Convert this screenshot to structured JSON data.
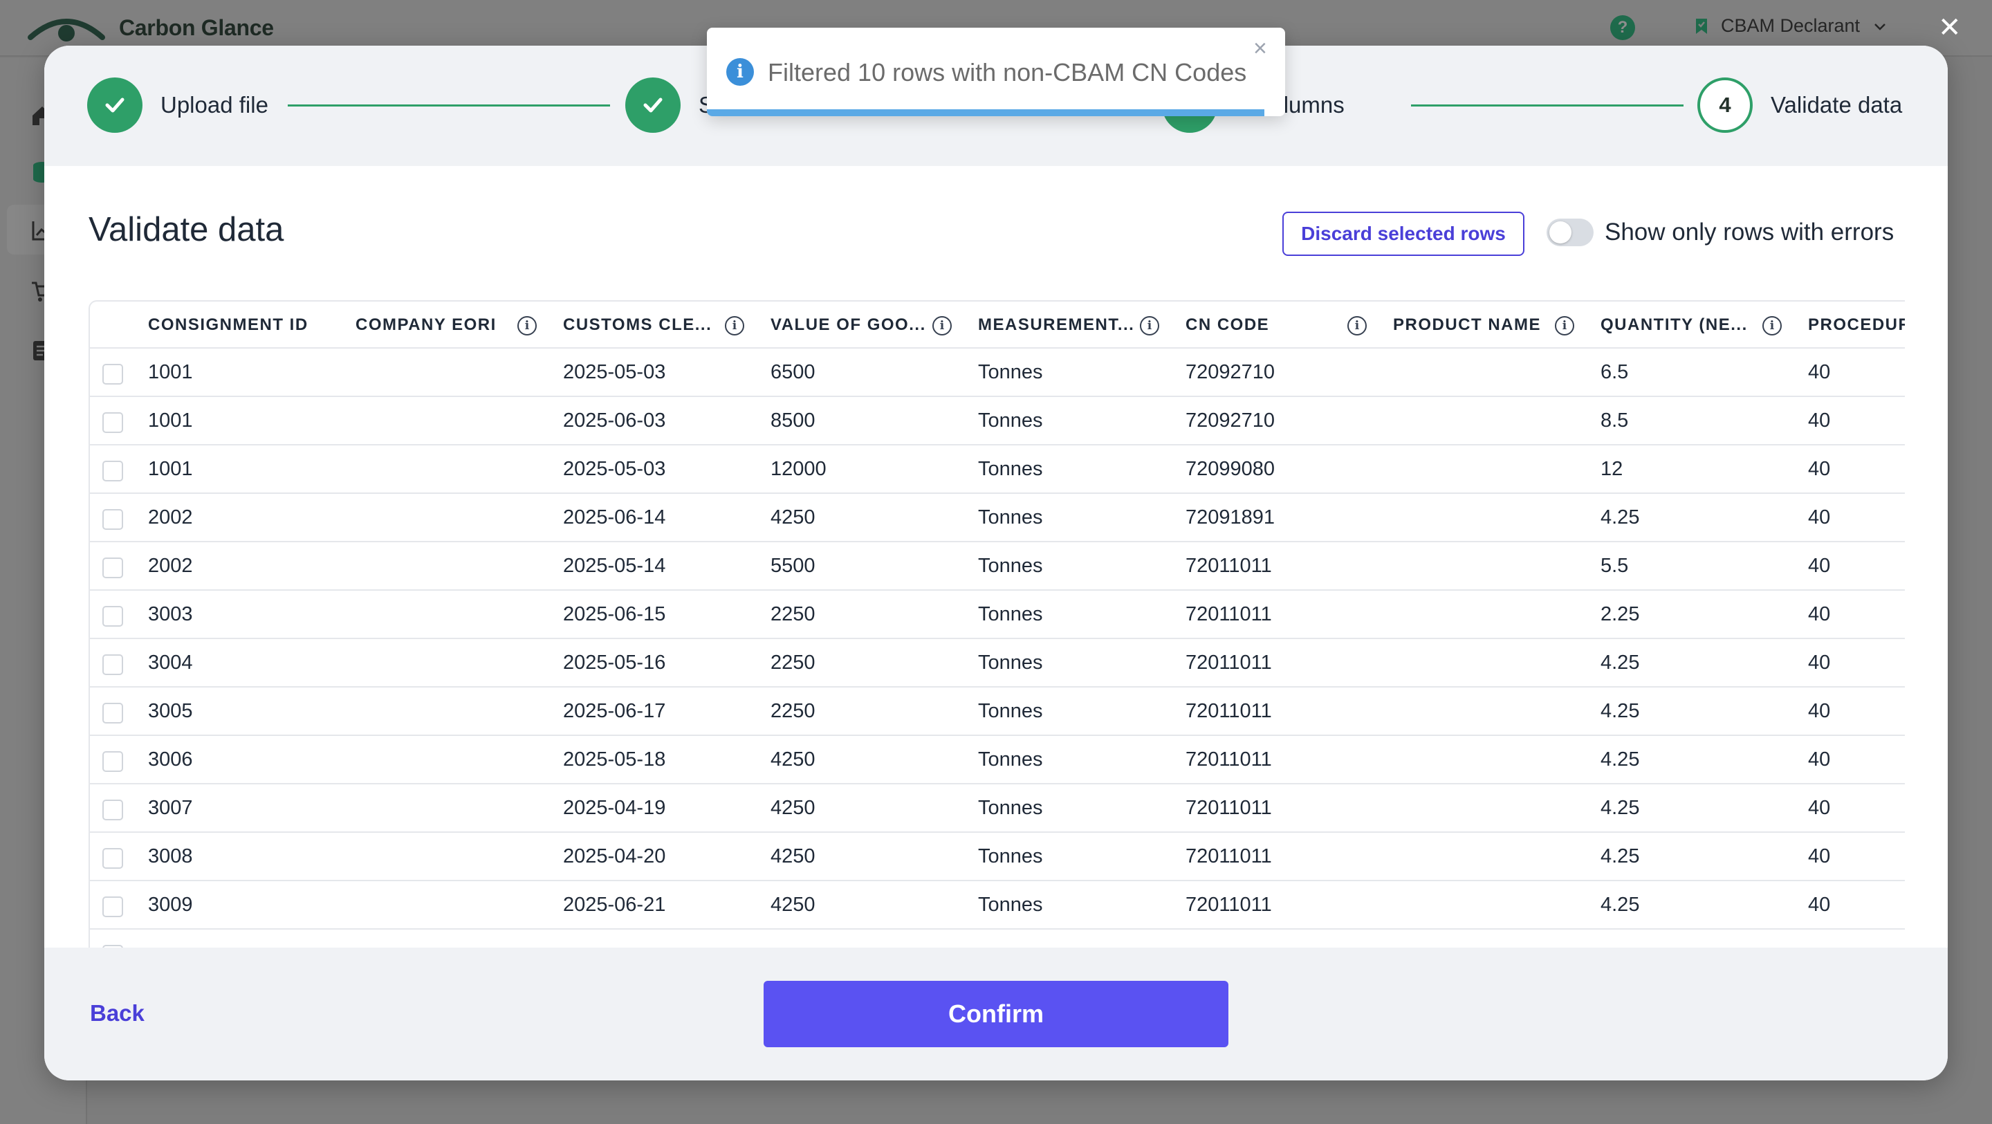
{
  "app": {
    "brand": "Carbon Glance",
    "role": "CBAM Declarant",
    "help_glyph": "?",
    "close_glyph": "✕",
    "colors": {
      "accent": "#5a52f2",
      "success": "#2e9f68",
      "info": "#3b8fd9"
    }
  },
  "toast": {
    "icon": "info-icon",
    "glyph": "i",
    "message": "Filtered 10 rows with non-CBAM CN Codes",
    "close_glyph": "×"
  },
  "stepper": {
    "steps": [
      {
        "label": "Upload file",
        "status": "complete"
      },
      {
        "label": "S",
        "status": "complete"
      },
      {
        "label": "h Columns",
        "status": "complete"
      },
      {
        "label": "Validate data",
        "status": "current",
        "number": "4"
      }
    ]
  },
  "main": {
    "title": "Validate data",
    "discard_label": "Discard selected rows",
    "toggle_label": "Show only rows with errors",
    "toggle_on": false
  },
  "table": {
    "info_glyph": "i",
    "columns": [
      {
        "label": "CONSIGNMENT ID",
        "info": false
      },
      {
        "label": "COMPANY EORI",
        "info": true
      },
      {
        "label": "CUSTOMS CLE...",
        "info": true
      },
      {
        "label": "VALUE OF GOO...",
        "info": true
      },
      {
        "label": "MEASUREMENT...",
        "info": true
      },
      {
        "label": "CN CODE",
        "info": true
      },
      {
        "label": "PRODUCT NAME",
        "info": true
      },
      {
        "label": "QUANTITY (NE...",
        "info": true
      },
      {
        "label": "PROCEDUR",
        "info": false
      }
    ],
    "rows": [
      [
        "1001",
        "",
        "2025-05-03",
        "6500",
        "Tonnes",
        "72092710",
        "",
        "6.5",
        "40"
      ],
      [
        "1001",
        "",
        "2025-06-03",
        "8500",
        "Tonnes",
        "72092710",
        "",
        "8.5",
        "40"
      ],
      [
        "1001",
        "",
        "2025-05-03",
        "12000",
        "Tonnes",
        "72099080",
        "",
        "12",
        "40"
      ],
      [
        "2002",
        "",
        "2025-06-14",
        "4250",
        "Tonnes",
        "72091891",
        "",
        "4.25",
        "40"
      ],
      [
        "2002",
        "",
        "2025-05-14",
        "5500",
        "Tonnes",
        "72011011",
        "",
        "5.5",
        "40"
      ],
      [
        "3003",
        "",
        "2025-06-15",
        "2250",
        "Tonnes",
        "72011011",
        "",
        "2.25",
        "40"
      ],
      [
        "3004",
        "",
        "2025-05-16",
        "2250",
        "Tonnes",
        "72011011",
        "",
        "4.25",
        "40"
      ],
      [
        "3005",
        "",
        "2025-06-17",
        "2250",
        "Tonnes",
        "72011011",
        "",
        "4.25",
        "40"
      ],
      [
        "3006",
        "",
        "2025-05-18",
        "4250",
        "Tonnes",
        "72011011",
        "",
        "4.25",
        "40"
      ],
      [
        "3007",
        "",
        "2025-04-19",
        "4250",
        "Tonnes",
        "72011011",
        "",
        "4.25",
        "40"
      ],
      [
        "3008",
        "",
        "2025-04-20",
        "4250",
        "Tonnes",
        "72011011",
        "",
        "4.25",
        "40"
      ],
      [
        "3009",
        "",
        "2025-06-21",
        "4250",
        "Tonnes",
        "72011011",
        "",
        "4.25",
        "40"
      ]
    ]
  },
  "footer": {
    "back_label": "Back",
    "confirm_label": "Confirm"
  }
}
